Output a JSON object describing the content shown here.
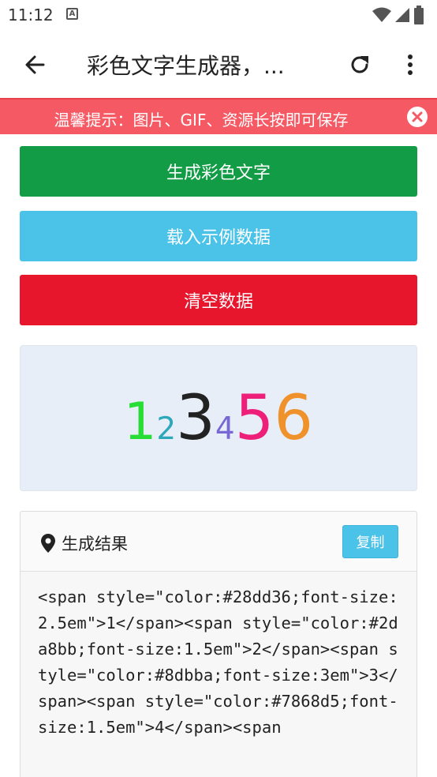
{
  "status_bar": {
    "time": "11:12",
    "notification_glyph": "A",
    "icons": [
      "wifi-icon",
      "signal-icon",
      "battery-icon"
    ]
  },
  "app_bar": {
    "title": "彩色文字生成器，...",
    "icons": [
      "back-arrow-icon",
      "refresh-icon",
      "more-vert-icon"
    ]
  },
  "tip_banner": {
    "text": "温馨提示：图片、GIF、资源长按即可保存",
    "background": "#f55a64",
    "close_icon": "close-icon"
  },
  "buttons": {
    "generate": "生成彩色文字",
    "load_example": "载入示例数据",
    "clear": "清空数据"
  },
  "colors": {
    "generate": "#119c45",
    "load_example": "#4bc3e8",
    "clear": "#e8162d",
    "preview_bg": "#e8eef7"
  },
  "preview": {
    "chars": [
      {
        "text": "1",
        "color": "#28dd36",
        "size": "2.5em"
      },
      {
        "text": "2",
        "color": "#2da8bb",
        "size": "1.5em"
      },
      {
        "text": "3",
        "color": "#222222",
        "size": "3em"
      },
      {
        "text": "4",
        "color": "#7868d5",
        "size": "1.5em"
      },
      {
        "text": "5",
        "color": "#ee1f78",
        "size": "3em"
      },
      {
        "text": "6",
        "color": "#f0922b",
        "size": "3em"
      }
    ]
  },
  "result": {
    "title": "生成结果",
    "copy_label": "复制",
    "pin_icon": "location-pin-icon",
    "code": "<span style=\"color:#28dd36;font-size:2.5em\">1</span><span style=\"color:#2da8bb;font-size:1.5em\">2</span><span style=\"color:#8dbba;font-size:3em\">3</span><span style=\"color:#7868d5;font-size:1.5em\">4</span><span"
  }
}
